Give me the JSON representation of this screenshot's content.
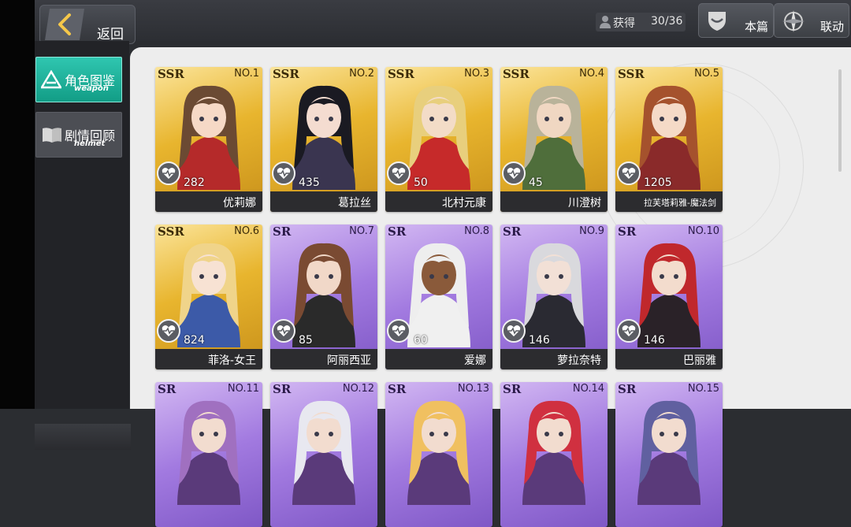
{
  "header": {
    "back_label": "返回",
    "obtained_label": "获得",
    "obtained_count": "30/36",
    "buttons": [
      {
        "label": "本篇",
        "icon": "shield-icon"
      },
      {
        "label": "联动",
        "icon": "compass-icon"
      }
    ]
  },
  "sidebar": {
    "items": [
      {
        "label": "角色图鉴",
        "sub": "weapon",
        "icon": "triangle-icon",
        "active": true
      },
      {
        "label": "剧情回顾",
        "sub": "helmet",
        "icon": "book-icon",
        "active": false
      }
    ]
  },
  "cards": [
    {
      "rarity": "SSR",
      "no": "NO.1",
      "fav": "282",
      "name": "优莉娜",
      "hair": "#6b4a33",
      "skin": "#f6d9c6",
      "accent": "#b52a2a"
    },
    {
      "rarity": "SSR",
      "no": "NO.2",
      "fav": "435",
      "name": "葛拉丝",
      "hair": "#1a1a22",
      "skin": "#f4dcd0",
      "accent": "#3a3550"
    },
    {
      "rarity": "SSR",
      "no": "NO.3",
      "fav": "50",
      "name": "北村元康",
      "hair": "#e8cf7d",
      "skin": "#f3dcc7",
      "accent": "#c62a2a"
    },
    {
      "rarity": "SSR",
      "no": "NO.4",
      "fav": "45",
      "name": "川澄树",
      "hair": "#b9b39a",
      "skin": "#f0d7c2",
      "accent": "#4f6e3b"
    },
    {
      "rarity": "SSR",
      "no": "NO.5",
      "fav": "1205",
      "name": "拉芙塔莉雅-魔法剑",
      "hair": "#a5522d",
      "skin": "#f5dac7",
      "accent": "#8a2a2a"
    },
    {
      "rarity": "SSR",
      "no": "NO.6",
      "fav": "824",
      "name": "菲洛-女王",
      "hair": "#f0d48a",
      "skin": "#f7e2d3",
      "accent": "#3c5aa8"
    },
    {
      "rarity": "SR",
      "no": "NO.7",
      "fav": "85",
      "name": "阿丽西亚",
      "hair": "#7a4a32",
      "skin": "#f1d8c8",
      "accent": "#2a2a2a"
    },
    {
      "rarity": "SR",
      "no": "NO.8",
      "fav": "60",
      "name": "爱娜",
      "hair": "#eeeeee",
      "skin": "#8a5a3a",
      "accent": "#f0f0f0"
    },
    {
      "rarity": "SR",
      "no": "NO.9",
      "fav": "146",
      "name": "萝拉奈特",
      "hair": "#d9d9dd",
      "skin": "#f2e0d6",
      "accent": "#2a2a32"
    },
    {
      "rarity": "SR",
      "no": "NO.10",
      "fav": "146",
      "name": "巴丽雅",
      "hair": "#c0282c",
      "skin": "#f3dccd",
      "accent": "#2a2228"
    },
    {
      "rarity": "SR",
      "no": "NO.11",
      "fav": "",
      "name": "",
      "hair": "#a070c0",
      "skin": "#f2dccf",
      "accent": "#5a3a7a"
    },
    {
      "rarity": "SR",
      "no": "NO.12",
      "fav": "",
      "name": "",
      "hair": "#e8e8f0",
      "skin": "#f2dccf",
      "accent": "#5a3a7a"
    },
    {
      "rarity": "SR",
      "no": "NO.13",
      "fav": "",
      "name": "",
      "hair": "#f0c060",
      "skin": "#f2dccf",
      "accent": "#5a3a7a"
    },
    {
      "rarity": "SR",
      "no": "NO.14",
      "fav": "",
      "name": "",
      "hair": "#d03040",
      "skin": "#f2dccf",
      "accent": "#5a3a7a"
    },
    {
      "rarity": "SR",
      "no": "NO.15",
      "fav": "",
      "name": "",
      "hair": "#6060a0",
      "skin": "#f2dccf",
      "accent": "#5a3a7a"
    }
  ]
}
